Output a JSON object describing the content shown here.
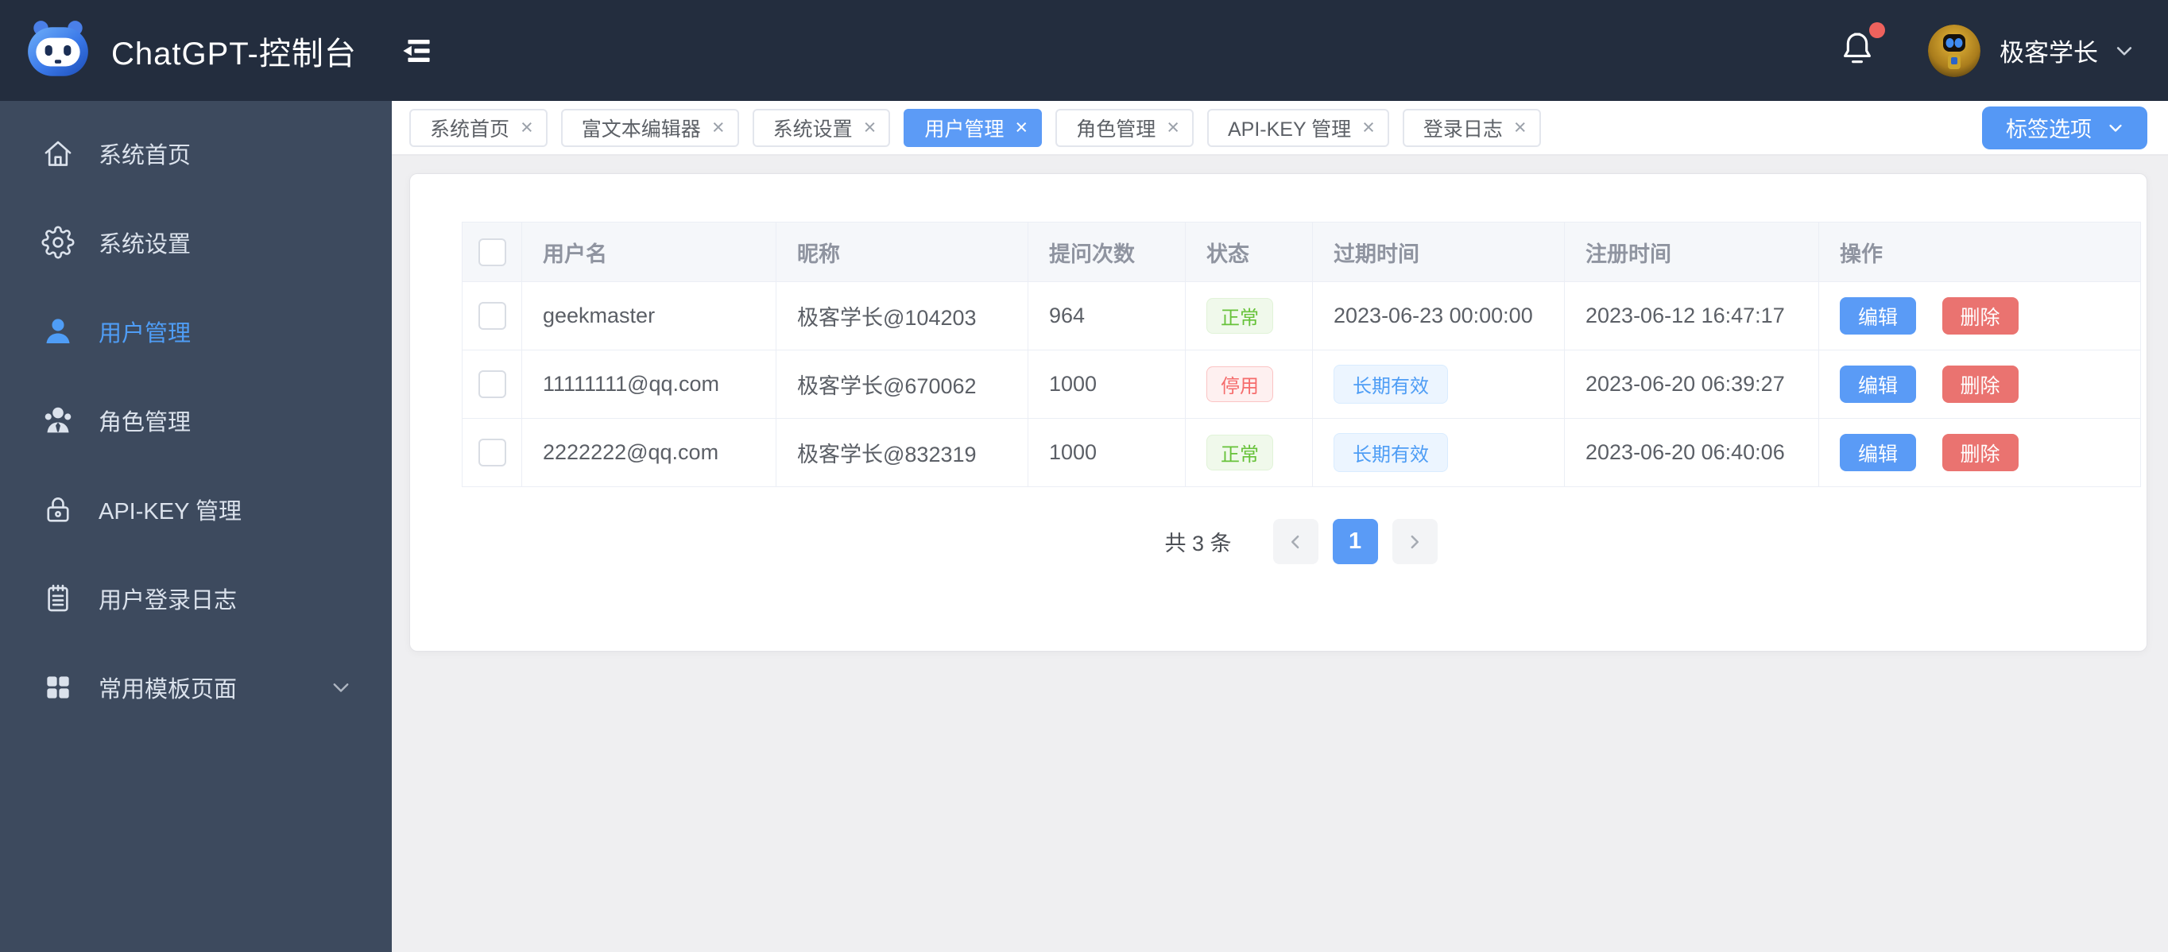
{
  "header": {
    "title": "ChatGPT-控制台",
    "user_name": "极客学长",
    "has_notification": true
  },
  "sidebar": {
    "items": [
      {
        "label": "系统首页",
        "icon": "home-icon",
        "active": false
      },
      {
        "label": "系统设置",
        "icon": "gear-icon",
        "active": false
      },
      {
        "label": "用户管理",
        "icon": "user-icon",
        "active": true
      },
      {
        "label": "角色管理",
        "icon": "roles-icon",
        "active": false
      },
      {
        "label": "API-KEY 管理",
        "icon": "lock-icon",
        "active": false
      },
      {
        "label": "用户登录日志",
        "icon": "log-icon",
        "active": false
      },
      {
        "label": "常用模板页面",
        "icon": "grid-icon",
        "active": false,
        "expandable": true
      }
    ]
  },
  "tabbar": {
    "tabs": [
      {
        "label": "系统首页",
        "active": false
      },
      {
        "label": "富文本编辑器",
        "active": false
      },
      {
        "label": "系统设置",
        "active": false
      },
      {
        "label": "用户管理",
        "active": true
      },
      {
        "label": "角色管理",
        "active": false
      },
      {
        "label": "API-KEY 管理",
        "active": false
      },
      {
        "label": "登录日志",
        "active": false
      }
    ],
    "close_glyph": "×",
    "options_button_label": "标签选项"
  },
  "table": {
    "columns": [
      "用户名",
      "昵称",
      "提问次数",
      "状态",
      "过期时间",
      "注册时间",
      "操作"
    ],
    "actions": {
      "edit": "编辑",
      "delete": "删除"
    },
    "rows": [
      {
        "username": "geekmaster",
        "nickname": "极客学长@104203",
        "question_count": "964",
        "status": "正常",
        "status_type": "success",
        "expire": "2023-06-23 00:00:00",
        "expire_type": "text",
        "registered": "2023-06-12 16:47:17"
      },
      {
        "username": "11111111@qq.com",
        "nickname": "极客学长@670062",
        "question_count": "1000",
        "status": "停用",
        "status_type": "danger",
        "expire": "长期有效",
        "expire_type": "tag",
        "registered": "2023-06-20 06:39:27"
      },
      {
        "username": "2222222@qq.com",
        "nickname": "极客学长@832319",
        "question_count": "1000",
        "status": "正常",
        "status_type": "success",
        "expire": "长期有效",
        "expire_type": "tag",
        "registered": "2023-06-20 06:40:06"
      }
    ]
  },
  "pagination": {
    "total_label": "共 3 条",
    "current_page": "1"
  },
  "colors": {
    "header_bg": "#232d3e",
    "sidebar_bg": "#3d4a5e",
    "primary_blue": "#5a9bf6",
    "menu_active_blue": "#4f9df6",
    "danger_red": "#ea7370",
    "success_green": "#67c23a",
    "tag_blue": "#4e9df5",
    "notification_dot": "#ef625d",
    "content_bg": "#efeff1",
    "table_header_bg": "#f5f7fa",
    "table_border": "#ebeef5"
  }
}
